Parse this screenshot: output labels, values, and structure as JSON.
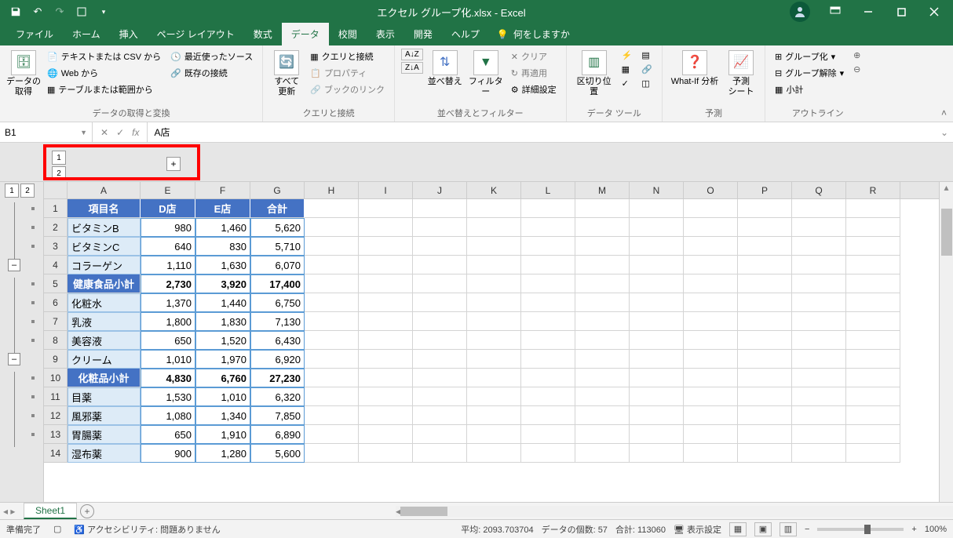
{
  "title": "エクセル グループ化.xlsx  -  Excel",
  "tabs": [
    "ファイル",
    "ホーム",
    "挿入",
    "ページ レイアウト",
    "数式",
    "データ",
    "校閲",
    "表示",
    "開発",
    "ヘルプ"
  ],
  "tellme": "何をしますか",
  "ribbon": {
    "g1_big": "データの\n取得",
    "g1_items": [
      "テキストまたは CSV から",
      "Web から",
      "テーブルまたは範囲から"
    ],
    "g1_right": [
      "最近使ったソース",
      "既存の接続"
    ],
    "g1_label": "データの取得と変換",
    "g2_big": "すべて\n更新",
    "g2_items": [
      "クエリと接続",
      "プロパティ",
      "ブックのリンク"
    ],
    "g2_label": "クエリと接続",
    "g3_sort": "並べ替え",
    "g3_filter": "フィルター",
    "g3_items": [
      "クリア",
      "再適用",
      "詳細設定"
    ],
    "g3_label": "並べ替えとフィルター",
    "g4_big": "区切り位置",
    "g4_label": "データ ツール",
    "g5_a": "What-If 分析",
    "g5_b": "予測\nシート",
    "g5_label": "予測",
    "g6_items": [
      "グループ化",
      "グループ解除",
      "小計"
    ],
    "g6_label": "アウトライン"
  },
  "namebox": "B1",
  "formula": "A店",
  "col_outline": {
    "lvl1": "1",
    "lvl2": "2",
    "plus": "+"
  },
  "row_lvls": [
    "1",
    "2"
  ],
  "columns": [
    "A",
    "E",
    "F",
    "G",
    "H",
    "I",
    "J",
    "K",
    "L",
    "M",
    "N",
    "O",
    "P",
    "Q",
    "R"
  ],
  "col_widths": [
    "wA",
    "wE",
    "wF",
    "wG",
    "wRest",
    "wRest",
    "wRest",
    "wRest",
    "wRest",
    "wRest",
    "wRest",
    "wRest",
    "wRest",
    "wRest",
    "wRest"
  ],
  "headers_row": [
    "項目名",
    "D店",
    "E店",
    "合計"
  ],
  "rows": [
    {
      "n": 2,
      "a": "ビタミンB",
      "d": "980",
      "e": "1,460",
      "g": "5,620"
    },
    {
      "n": 3,
      "a": "ビタミンC",
      "d": "640",
      "e": "830",
      "g": "5,710"
    },
    {
      "n": 4,
      "a": "コラーゲン",
      "d": "1,110",
      "e": "1,630",
      "g": "6,070"
    },
    {
      "n": 5,
      "a": "健康食品小計",
      "d": "2,730",
      "e": "3,920",
      "g": "17,400",
      "sub": true
    },
    {
      "n": 6,
      "a": "化粧水",
      "d": "1,370",
      "e": "1,440",
      "g": "6,750"
    },
    {
      "n": 7,
      "a": "乳液",
      "d": "1,800",
      "e": "1,830",
      "g": "7,130"
    },
    {
      "n": 8,
      "a": "美容液",
      "d": "650",
      "e": "1,520",
      "g": "6,430"
    },
    {
      "n": 9,
      "a": "クリーム",
      "d": "1,010",
      "e": "1,970",
      "g": "6,920"
    },
    {
      "n": 10,
      "a": "化粧品小計",
      "d": "4,830",
      "e": "6,760",
      "g": "27,230",
      "sub": true
    },
    {
      "n": 11,
      "a": "目薬",
      "d": "1,530",
      "e": "1,010",
      "g": "6,320"
    },
    {
      "n": 12,
      "a": "風邪薬",
      "d": "1,080",
      "e": "1,340",
      "g": "7,850"
    },
    {
      "n": 13,
      "a": "胃腸薬",
      "d": "650",
      "e": "1,910",
      "g": "6,890"
    },
    {
      "n": 14,
      "a": "湿布薬",
      "d": "900",
      "e": "1,280",
      "g": "5,600"
    }
  ],
  "sheet_tab": "Sheet1",
  "status": {
    "ready": "準備完了",
    "acc": "アクセシビリティ: 問題ありません",
    "avg": "平均: 2093.703704",
    "count": "データの個数: 57",
    "sum": "合計: 113060",
    "display": "表示設定",
    "zoom": "100%"
  }
}
